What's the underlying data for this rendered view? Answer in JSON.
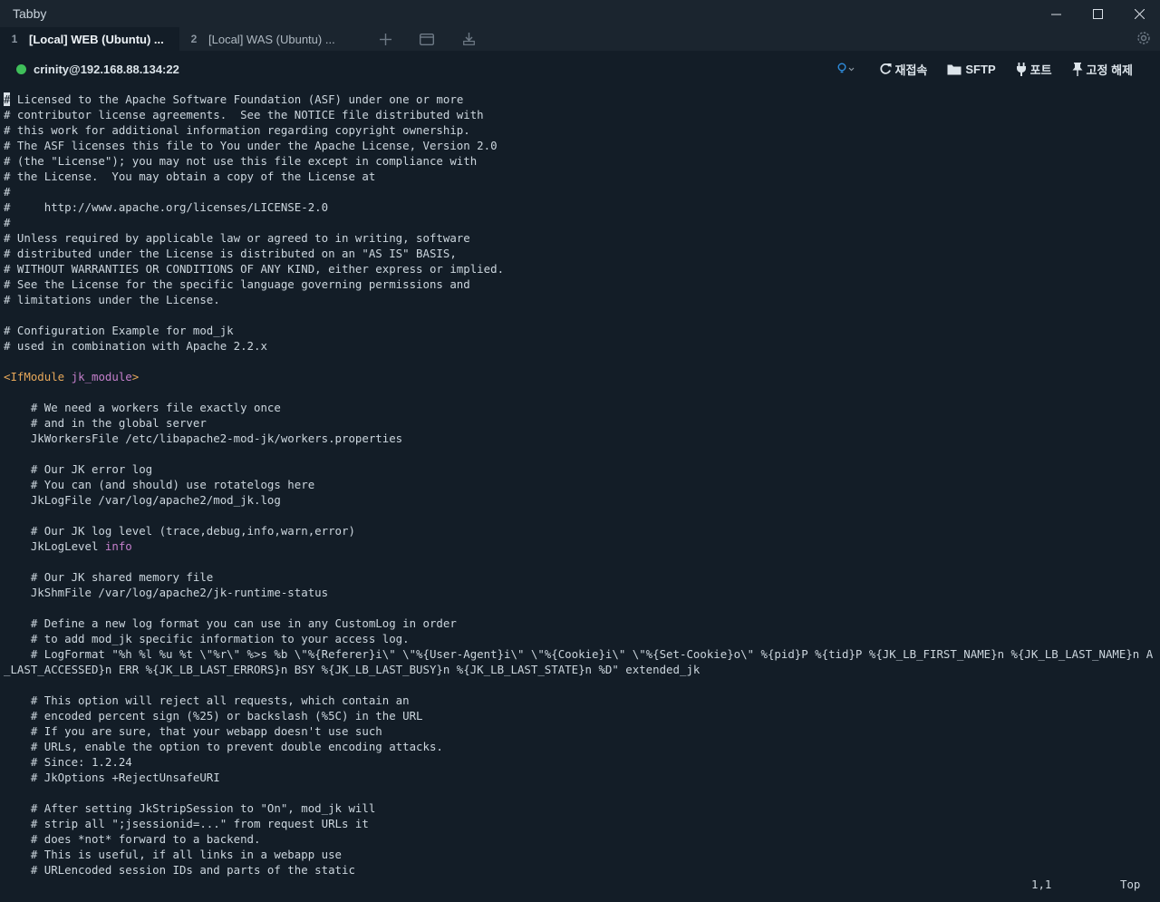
{
  "app": {
    "title": "Tabby"
  },
  "tabs": [
    {
      "num": "1",
      "label": "[Local] WEB (Ubuntu) ...",
      "active": true
    },
    {
      "num": "2",
      "label": "[Local] WAS (Ubuntu) ...",
      "active": false
    }
  ],
  "connection": {
    "host": "crinity@192.168.88.134:22",
    "status_color": "#3fbf5a"
  },
  "toolbar": {
    "reconnect": "재접속",
    "sftp": "SFTP",
    "ports": "포트",
    "unpin": "고정 해제"
  },
  "terminal": {
    "lines": [
      "# Licensed to the Apache Software Foundation (ASF) under one or more",
      "# contributor license agreements.  See the NOTICE file distributed with",
      "# this work for additional information regarding copyright ownership.",
      "# The ASF licenses this file to You under the Apache License, Version 2.0",
      "# (the \"License\"); you may not use this file except in compliance with",
      "# the License.  You may obtain a copy of the License at",
      "#",
      "#     http://www.apache.org/licenses/LICENSE-2.0",
      "#",
      "# Unless required by applicable law or agreed to in writing, software",
      "# distributed under the License is distributed on an \"AS IS\" BASIS,",
      "# WITHOUT WARRANTIES OR CONDITIONS OF ANY KIND, either express or implied.",
      "# See the License for the specific language governing permissions and",
      "# limitations under the License.",
      "",
      "# Configuration Example for mod_jk",
      "# used in combination with Apache 2.2.x",
      "",
      "<IfModule jk_module>",
      "",
      "    # We need a workers file exactly once",
      "    # and in the global server",
      "    JkWorkersFile /etc/libapache2-mod-jk/workers.properties",
      "",
      "    # Our JK error log",
      "    # You can (and should) use rotatelogs here",
      "    JkLogFile /var/log/apache2/mod_jk.log",
      "",
      "    # Our JK log level (trace,debug,info,warn,error)",
      "    JkLogLevel info",
      "",
      "    # Our JK shared memory file",
      "    JkShmFile /var/log/apache2/jk-runtime-status",
      "",
      "    # Define a new log format you can use in any CustomLog in order",
      "    # to add mod_jk specific information to your access log.",
      "    # LogFormat \"%h %l %u %t \\\"%r\\\" %>s %b \\\"%{Referer}i\\\" \\\"%{User-Agent}i\\\" \\\"%{Cookie}i\\\" \\\"%{Set-Cookie}o\\\" %{pid}P %{tid}P %{JK_LB_FIRST_NAME}n %{JK_LB_LAST_NAME}n ACC %{JK_LB",
      "_LAST_ACCESSED}n ERR %{JK_LB_LAST_ERRORS}n BSY %{JK_LB_LAST_BUSY}n %{JK_LB_LAST_STATE}n %D\" extended_jk",
      "",
      "    # This option will reject all requests, which contain an",
      "    # encoded percent sign (%25) or backslash (%5C) in the URL",
      "    # If you are sure, that your webapp doesn't use such",
      "    # URLs, enable the option to prevent double encoding attacks.",
      "    # Since: 1.2.24",
      "    # JkOptions +RejectUnsafeURI",
      "",
      "    # After setting JkStripSession to \"On\", mod_jk will",
      "    # strip all \";jsessionid=...\" from request URLs it",
      "    # does *not* forward to a backend.",
      "    # This is useful, if all links in a webapp use",
      "    # URLencoded session IDs and parts of the static"
    ],
    "cursor_position": "1,1",
    "scroll_position": "Top"
  },
  "colors": {
    "background": "#131d27",
    "tag": "#e7a85a",
    "attribute": "#c47fcb"
  }
}
